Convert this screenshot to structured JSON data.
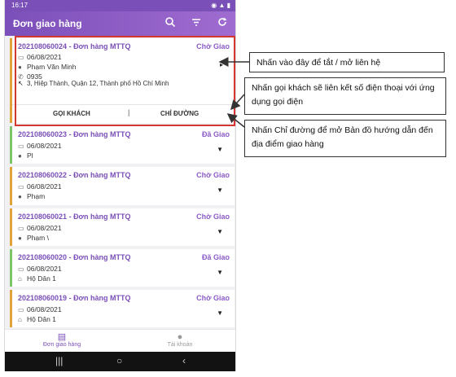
{
  "status_bar": {
    "time": "16:17",
    "right": "◉ ▲ ▮"
  },
  "header": {
    "title": "Đơn giao hàng"
  },
  "orders": [
    {
      "id": "202108060024 - Đơn hàng MTTQ",
      "status": "Chờ Giao",
      "date": "06/08/2021",
      "name": "Phạm Văn Minh",
      "phone": "0935",
      "address": "3, Hiệp Thành, Quận 12, Thành phố Hồ Chí Minh",
      "call_label": "GỌI KHÁCH",
      "separator": "|",
      "directions_label": "CHỈ ĐƯỜNG"
    },
    {
      "id": "202108060023 - Đơn hàng MTTQ",
      "status": "Đã Giao",
      "date": "06/08/2021",
      "name": "Pl"
    },
    {
      "id": "202108060022 - Đơn hàng MTTQ",
      "status": "Chờ Giao",
      "date": "06/08/2021",
      "name": "Phạm"
    },
    {
      "id": "202108060021 - Đơn hàng MTTQ",
      "status": "Chờ Giao",
      "date": "06/08/2021",
      "name": "Phạm \\"
    },
    {
      "id": "202108060020 - Đơn hàng MTTQ",
      "status": "Đã Giao",
      "date": "06/08/2021",
      "name": "Hộ Dân 1"
    },
    {
      "id": "202108060019 - Đơn hàng MTTQ",
      "status": "Chờ Giao",
      "date": "06/08/2021",
      "name": "Hộ Dân 1"
    }
  ],
  "bottom_nav": {
    "orders_tab": "Đơn giao hàng",
    "account_tab": "Tài khoản"
  },
  "callouts": {
    "toggle": "Nhấn vào đây để tắt / mở liên hệ",
    "call": "Nhấn gọi khách sẽ liên kết số điện thoại với ứng dụng gọi điện",
    "directions": "Nhấn Chỉ đường để mở Bản đồ hướng dẫn đến địa điểm giao hàng"
  },
  "colors": {
    "accent": "#7a4fb8",
    "pending": "#e3a13a",
    "delivered": "#7ec46a",
    "highlight": "#d4372f"
  }
}
